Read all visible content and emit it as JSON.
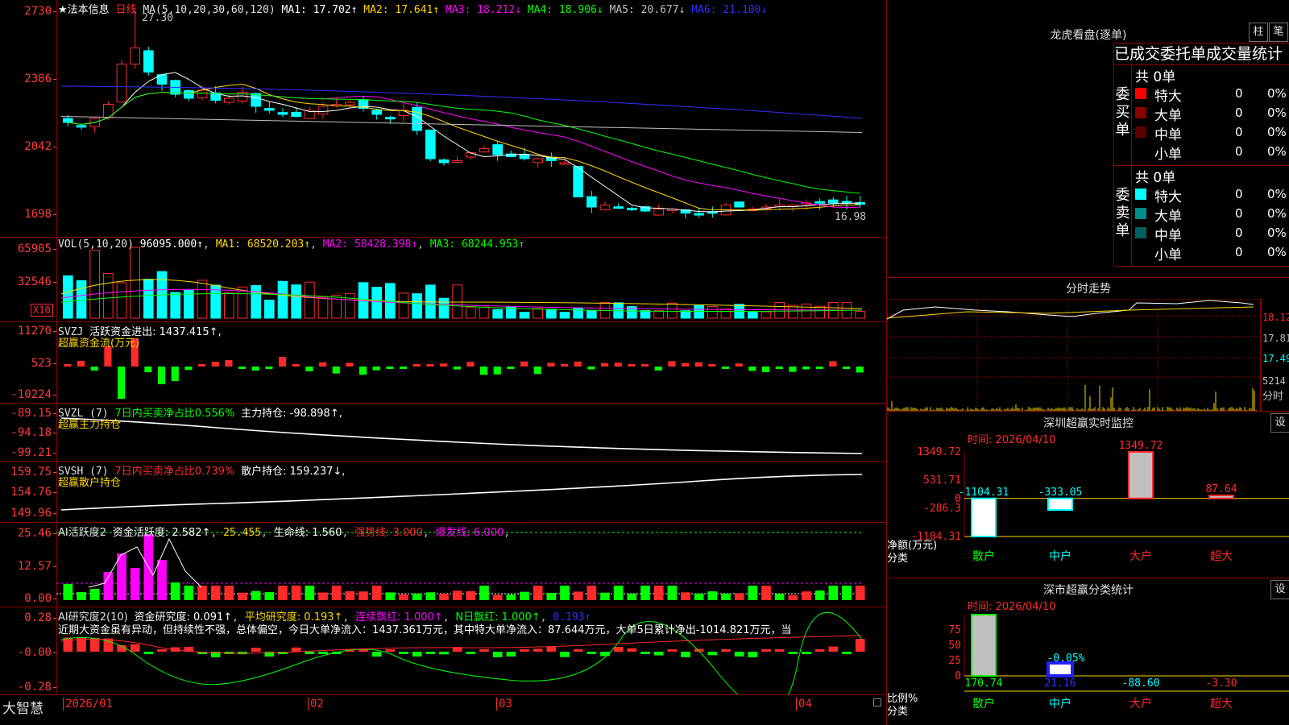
{
  "main": {
    "title": "★法本信息",
    "period": "日线",
    "ma_label": "MA(5,10,20,30,60,120)",
    "ma1": "MA1: 17.702↑",
    "ma2": "MA2: 17.641↑",
    "ma3": "MA3: 18.212↓",
    "ma4": "MA4: 18.906↓",
    "ma5": "MA5: 20.677↓",
    "ma6": "MA6: 21.100↓",
    "ticks": [
      "2730",
      "2386",
      "2042",
      "1698"
    ],
    "high_label": "27.30",
    "low_label": "16.98",
    "colors": {
      "up": "#ff2a2a",
      "down": "#00ffff",
      "ma1": "#ffffff",
      "ma2": "#ffd700",
      "ma3": "#ff00ff",
      "ma4": "#00ff00",
      "ma5": "#c0c0c0",
      "ma6": "#3030ff"
    }
  },
  "vol": {
    "label": "VOL(5,10,20)",
    "value": "96095.000↑",
    "ma1": "MA1: 68520.203↑",
    "ma2": "MA2: 58428.398↑",
    "ma3": "MA3: 68244.953↑",
    "ticks": [
      "65905",
      "32546"
    ],
    "unit": "X10"
  },
  "svzj": {
    "label": "SVZJ",
    "desc": "活跃资金进出: 1437.415↑,",
    "sub": "超赢资金流(万元)",
    "ticks": [
      "11270",
      "523",
      "-10224"
    ]
  },
  "svzl": {
    "label": "SVZL (7)",
    "ratio": "7日内买卖净占比0.556%",
    "hold": "主力持仓: -98.898↑,",
    "sub": "超赢主力持仓",
    "ticks": [
      "-89.15",
      "-94.18",
      "-99.21"
    ]
  },
  "svsh": {
    "label": "SVSH (7)",
    "ratio": "7日内买卖净占比0.739%",
    "hold": "散户持仓: 159.237↓,",
    "sub": "超赢散户持仓",
    "ticks": [
      "159.75",
      "154.76",
      "149.96"
    ]
  },
  "ai1": {
    "label": "AI活跃度2",
    "v1": "资金活跃度: 2.582↑",
    "v2": "25.455",
    "v3": "生命线: 1.560",
    "v4": "强势线: 3.000",
    "v5": "爆发线: 6.000",
    "ticks": [
      "25.46",
      "12.57",
      "0.00"
    ]
  },
  "ai2": {
    "label": "AI研究度2(10)",
    "v1": "资金研究度: 0.091↑",
    "v2": "平均研究度: 0.193↑",
    "v3": "连续飘红: 1.000↑",
    "v4": "N日飘红: 1.000↑",
    "v5": "0.193↑",
    "note": "近期大资金虽有异动，但持续性不强，总体偏空，今日大单净流入：1437.361万元，其中特大单净流入：87.644万元，大单5日累计净出-1014.821万元，当",
    "ticks": [
      "0.28",
      "-0.00",
      "-0.28"
    ]
  },
  "xaxis": {
    "brand": "大智慧",
    "labels": [
      "2026/01",
      "02",
      "03",
      "04"
    ]
  },
  "lhb": {
    "title": "龙虎看盘(逐单)",
    "btn1": "柱",
    "btn2": "笔",
    "header": "已成交委托单成交量统计",
    "buy_side": "委买单",
    "sell_side": "委卖单",
    "buy_total": "共 0单",
    "sell_total": "共 0单",
    "rows": [
      {
        "name": "特大",
        "count": "0",
        "pct": "0%"
      },
      {
        "name": "大单",
        "count": "0",
        "pct": "0%"
      },
      {
        "name": "中单",
        "count": "0",
        "pct": "0%"
      },
      {
        "name": "小单",
        "count": "0",
        "pct": "0%"
      }
    ],
    "buy_colors": [
      "#ff0000",
      "#8b0000",
      "#5a0000",
      ""
    ],
    "sell_colors": [
      "#00ffff",
      "#008b8b",
      "#006060",
      ""
    ]
  },
  "fenshi": {
    "title": "分时走势",
    "ticks": [
      "18.12",
      "17.81",
      "17.49",
      "5214"
    ],
    "vol_label": "分时"
  },
  "monitor": {
    "title": "深圳超赢实时监控",
    "btn": "设",
    "time": "时间: 2026/04/10",
    "ticks": [
      "1349.72",
      "531.71",
      "0",
      "-286.3",
      "-1104.31"
    ],
    "ylabel": "净额(万元)",
    "xlabel": "分类",
    "categories": [
      "散户",
      "中户",
      "大户",
      "超大"
    ],
    "values": [
      -1104.31,
      -333.05,
      1349.72,
      87.64
    ],
    "value_labels": [
      "-1104.31",
      "-333.05",
      "1349.72",
      "87.64"
    ]
  },
  "classify": {
    "title": "深市超赢分类统计",
    "btn": "设",
    "time": "时间: 2026/04/10",
    "ticks": [
      "75",
      "50",
      "25",
      "0"
    ],
    "ylabel": "比例%",
    "xlabel": "分类",
    "categories": [
      "散户",
      "中户",
      "大户",
      "超大"
    ],
    "values": [
      170.74,
      21.16,
      -88.6,
      -3.3
    ],
    "value_labels": [
      "170.74",
      "21.16",
      "-88.60",
      "-3.30"
    ],
    "extra_label": "-0.05%"
  }
}
